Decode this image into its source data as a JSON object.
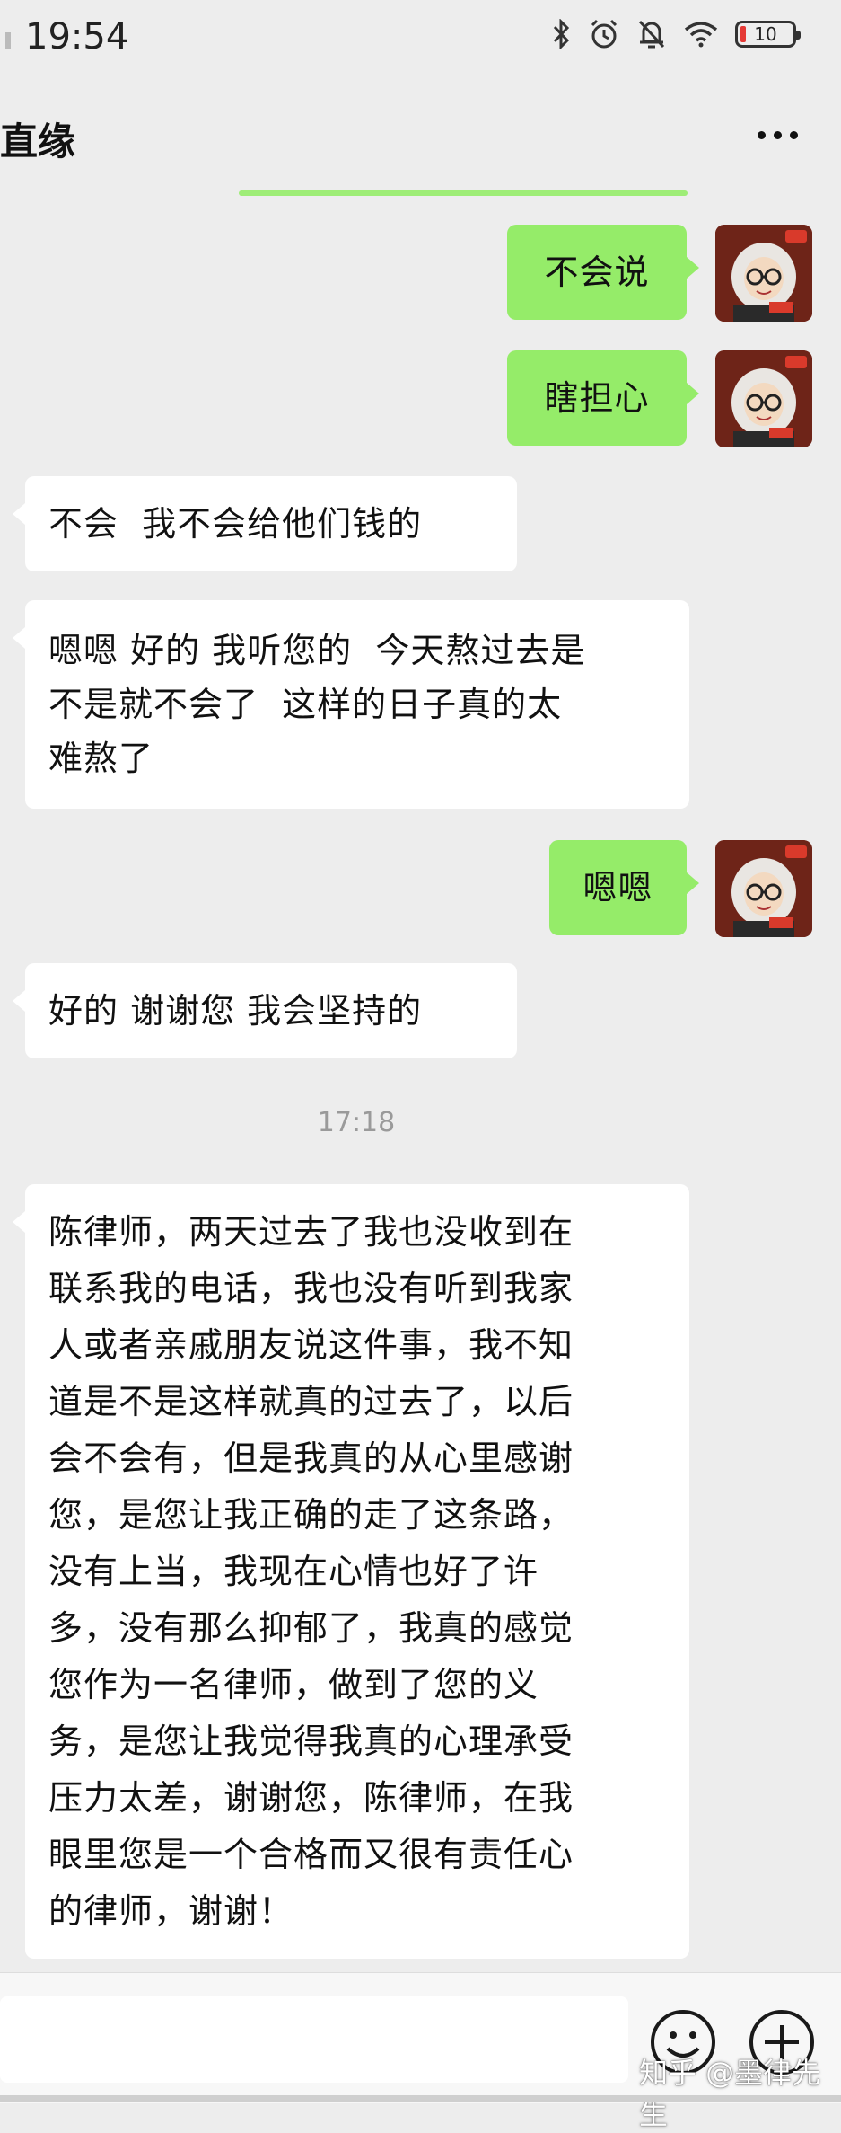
{
  "status_bar": {
    "time": "19:54",
    "icons": [
      "bluetooth-icon",
      "alarm-icon",
      "mute-icon",
      "wifi-icon"
    ],
    "battery_level": "10"
  },
  "header": {
    "title": "直缘",
    "more_icon": "more-icon"
  },
  "messages": [
    {
      "side": "me",
      "text": "不会说"
    },
    {
      "side": "me",
      "text": "瞎担心"
    },
    {
      "side": "other",
      "text": "不会  我不会给他们钱的"
    },
    {
      "side": "other",
      "lines": [
        "嗯嗯 好的 我听您的  今天熬过去是",
        "不是就不会了  这样的日子真的太",
        "难熬了"
      ]
    },
    {
      "side": "me",
      "text": "嗯嗯"
    },
    {
      "side": "other",
      "text": "好的 谢谢您 我会坚持的"
    },
    {
      "side": "time",
      "text": "17:18"
    },
    {
      "side": "other",
      "lines": [
        "陈律师，两天过去了我也没收到在",
        "联系我的电话，我也没有听到我家",
        "人或者亲戚朋友说这件事，我不知",
        "道是不是这样就真的过去了，以后",
        "会不会有，但是我真的从心里感谢",
        "您，是您让我正确的走了这条路，",
        "没有上当，我现在心情也好了许",
        "多，没有那么抑郁了，我真的感觉",
        "您作为一名律师，做到了您的义",
        "务，是您让我觉得我真的心理承受",
        "压力太差，谢谢您，陈律师，在我",
        "眼里您是一个合格而又很有责任心",
        "的律师，谢谢！"
      ]
    }
  ],
  "colors": {
    "my_bubble": "#95ec69",
    "other_bubble": "#ffffff",
    "background": "#ededed"
  },
  "input_bar": {
    "emoji_icon": "emoji-icon",
    "plus_icon": "plus-icon"
  },
  "watermark": "知乎 @墨律先生"
}
